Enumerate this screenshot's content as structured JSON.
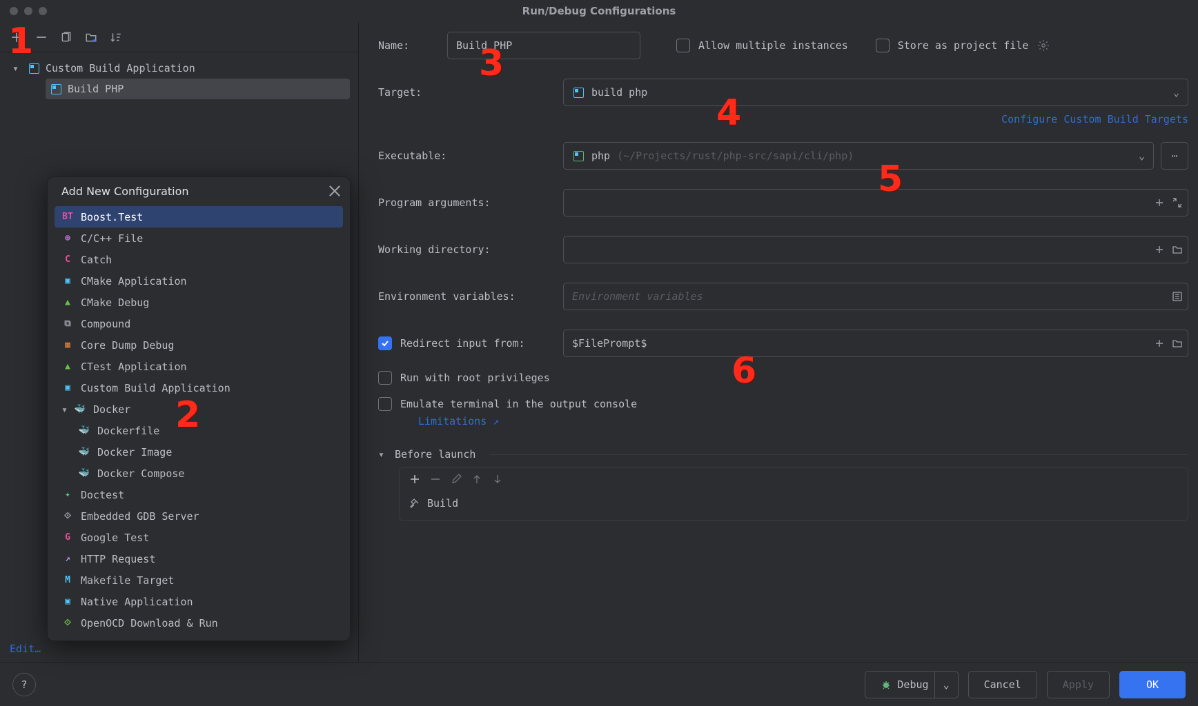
{
  "window": {
    "title": "Run/Debug Configurations"
  },
  "tree": {
    "group": "Custom Build Application",
    "item": "Build PHP"
  },
  "popup": {
    "title": "Add New Configuration",
    "items": [
      {
        "label": "Boost.Test",
        "icon": "BT",
        "color": "#e94f9b",
        "sel": true
      },
      {
        "label": "C/C++ File",
        "icon": "⊕",
        "color": "#c678dd"
      },
      {
        "label": "Catch",
        "icon": "C",
        "color": "#e94f9b"
      },
      {
        "label": "CMake Application",
        "icon": "▣",
        "color": "#4fc3f7"
      },
      {
        "label": "CMake Debug",
        "icon": "▲",
        "color": "#6abf4b"
      },
      {
        "label": "Compound",
        "icon": "⧉",
        "color": "#9da0a8"
      },
      {
        "label": "Core Dump Debug",
        "icon": "▦",
        "color": "#e57f3b"
      },
      {
        "label": "CTest Application",
        "icon": "▲",
        "color": "#6abf4b"
      },
      {
        "label": "Custom Build Application",
        "icon": "▣",
        "color": "#4fc3f7"
      },
      {
        "label": "Docker",
        "icon": "🐳",
        "color": "#3a8fd8",
        "expandable": true
      },
      {
        "label": "Dockerfile",
        "icon": "🐳",
        "color": "#3a8fd8",
        "indent": true
      },
      {
        "label": "Docker Image",
        "icon": "🐳",
        "color": "#3a8fd8",
        "indent": true
      },
      {
        "label": "Docker Compose",
        "icon": "🐳",
        "color": "#3a8fd8",
        "indent": true
      },
      {
        "label": "Doctest",
        "icon": "✦",
        "color": "#59c990"
      },
      {
        "label": "Embedded GDB Server",
        "icon": "⟐",
        "color": "#9da0a8"
      },
      {
        "label": "Google Test",
        "icon": "G",
        "color": "#e94f9b"
      },
      {
        "label": "HTTP Request",
        "icon": "↗",
        "color": "#b58de0"
      },
      {
        "label": "Makefile Target",
        "icon": "M",
        "color": "#4fc3f7"
      },
      {
        "label": "Native Application",
        "icon": "▣",
        "color": "#4fc3f7"
      },
      {
        "label": "OpenOCD Download & Run",
        "icon": "⟐",
        "color": "#6abf4b"
      }
    ]
  },
  "form": {
    "name_label": "Name:",
    "name_value": "Build PHP",
    "allow_multi": "Allow multiple instances",
    "store_project": "Store as project file",
    "target_label": "Target:",
    "target_value": "build php",
    "configure_targets": "Configure Custom Build Targets",
    "executable_label": "Executable:",
    "executable_value": "php",
    "executable_path": "(~/Projects/rust/php-src/sapi/cli/php)",
    "program_args_label": "Program arguments:",
    "working_dir_label": "Working directory:",
    "env_label": "Environment variables:",
    "env_placeholder": "Environment variables",
    "redirect_label": "Redirect input from:",
    "redirect_value": "$FilePrompt$",
    "root_priv": "Run with root privileges",
    "emulate_term": "Emulate terminal in the output console",
    "limitations": "Limitations",
    "before_launch": "Before launch",
    "build_task": "Build"
  },
  "buttons": {
    "edit_templates": "Edit…",
    "debug": "Debug",
    "cancel": "Cancel",
    "apply": "Apply",
    "ok": "OK"
  },
  "annotations": [
    "1",
    "2",
    "3",
    "4",
    "5",
    "6"
  ]
}
